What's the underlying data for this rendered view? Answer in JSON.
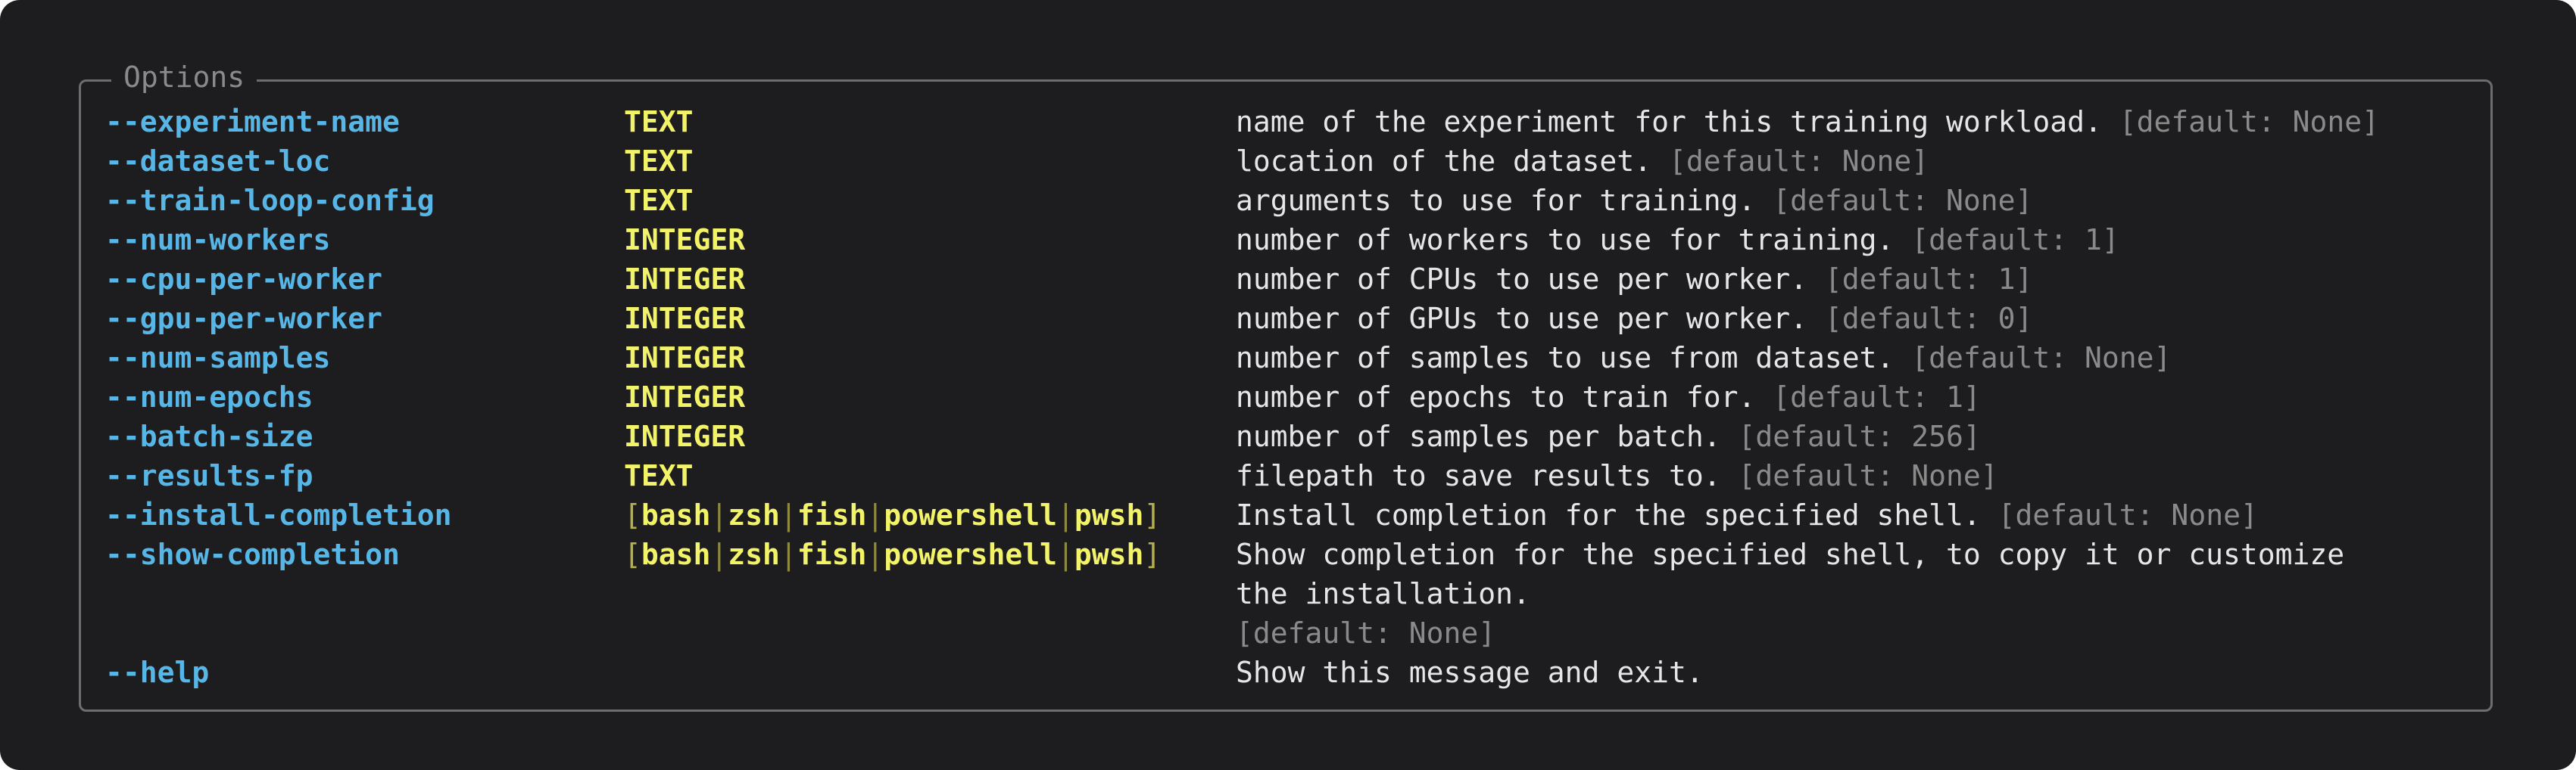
{
  "panel": {
    "title": "Options"
  },
  "options": [
    {
      "name": "--experiment-name",
      "type": "TEXT",
      "desc": "name of the experiment for this training workload.",
      "default": "[default: None]"
    },
    {
      "name": "--dataset-loc",
      "type": "TEXT",
      "desc": "location of the dataset.",
      "default": "[default: None]"
    },
    {
      "name": "--train-loop-config",
      "type": "TEXT",
      "desc": "arguments to use for training.",
      "default": "[default: None]"
    },
    {
      "name": "--num-workers",
      "type": "INTEGER",
      "desc": "number of workers to use for training.",
      "default": "[default: 1]"
    },
    {
      "name": "--cpu-per-worker",
      "type": "INTEGER",
      "desc": "number of CPUs to use per worker.",
      "default": "[default: 1]"
    },
    {
      "name": "--gpu-per-worker",
      "type": "INTEGER",
      "desc": "number of GPUs to use per worker.",
      "default": "[default: 0]"
    },
    {
      "name": "--num-samples",
      "type": "INTEGER",
      "desc": "number of samples to use from dataset.",
      "default": "[default: None]"
    },
    {
      "name": "--num-epochs",
      "type": "INTEGER",
      "desc": "number of epochs to train for.",
      "default": "[default: 1]"
    },
    {
      "name": "--batch-size",
      "type": "INTEGER",
      "desc": "number of samples per batch.",
      "default": "[default: 256]"
    },
    {
      "name": "--results-fp",
      "type": "TEXT",
      "desc": "filepath to save results to.",
      "default": "[default: None]"
    }
  ],
  "completion_shells": [
    "bash",
    "zsh",
    "fish",
    "powershell",
    "pwsh"
  ],
  "install_completion": {
    "name": "--install-completion",
    "desc": "Install completion for the specified shell.",
    "default": "[default: None]"
  },
  "show_completion": {
    "name": "--show-completion",
    "desc_line1": "Show completion for the specified shell, to copy it or customize",
    "desc_line2": "the installation.",
    "default": "[default: None]"
  },
  "help": {
    "name": "--help",
    "desc": "Show this message and exit."
  },
  "colors": {
    "background": "#1d1d1f",
    "option": "#57b6e6",
    "type": "#f3f36a",
    "text": "#e6e6e6",
    "muted": "#8a8a8a",
    "border": "#6d6d6d"
  }
}
